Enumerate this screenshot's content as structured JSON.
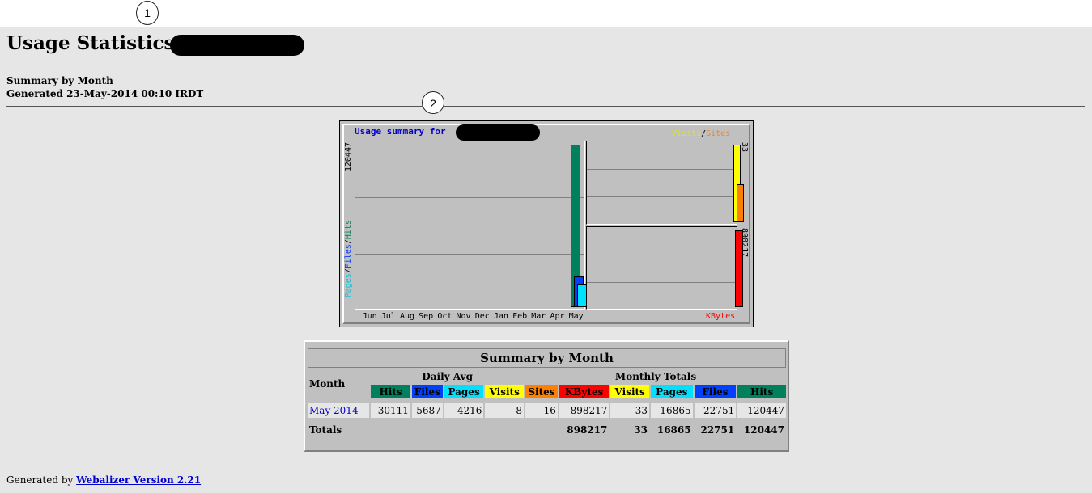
{
  "markers": [
    "1",
    "2"
  ],
  "page": {
    "title": "Usage Statistics for",
    "subtitle_line1": "Summary by Month",
    "subtitle_line2": "Generated 23-May-2014 00:10 IRDT"
  },
  "chart_data": {
    "type": "bar",
    "title": "Usage summary for",
    "categories": [
      "Jun",
      "Jul",
      "Aug",
      "Sep",
      "Oct",
      "Nov",
      "Dec",
      "Jan",
      "Feb",
      "Mar",
      "Apr",
      "May"
    ],
    "main_panel": {
      "max_label": "120447",
      "axis_label_parts": [
        "Pages",
        "/",
        "Files",
        "/",
        "Hits"
      ],
      "series": [
        {
          "name": "Hits",
          "color": "#00805c",
          "values": [
            0,
            0,
            0,
            0,
            0,
            0,
            0,
            0,
            0,
            0,
            0,
            120447
          ]
        },
        {
          "name": "Files",
          "color": "#0040ff",
          "values": [
            0,
            0,
            0,
            0,
            0,
            0,
            0,
            0,
            0,
            0,
            0,
            22751
          ]
        },
        {
          "name": "Pages",
          "color": "#00e0ff",
          "values": [
            0,
            0,
            0,
            0,
            0,
            0,
            0,
            0,
            0,
            0,
            0,
            16865
          ]
        }
      ],
      "ylim": [
        0,
        120447
      ]
    },
    "visits_panel": {
      "max_label": "33",
      "legend": [
        "Visits",
        "/",
        "Sites"
      ],
      "series": [
        {
          "name": "Visits",
          "color": "#ffff00",
          "values": [
            0,
            0,
            0,
            0,
            0,
            0,
            0,
            0,
            0,
            0,
            0,
            33
          ]
        },
        {
          "name": "Sites",
          "color": "#ff8000",
          "values": [
            0,
            0,
            0,
            0,
            0,
            0,
            0,
            0,
            0,
            0,
            0,
            16
          ]
        }
      ],
      "ylim": [
        0,
        33
      ]
    },
    "kbytes_panel": {
      "max_label": "898217",
      "label": "KBytes",
      "series": [
        {
          "name": "KBytes",
          "color": "#ff0000",
          "values": [
            0,
            0,
            0,
            0,
            0,
            0,
            0,
            0,
            0,
            0,
            0,
            898217
          ]
        }
      ],
      "ylim": [
        0,
        898217
      ]
    }
  },
  "table": {
    "title": "Summary by Month",
    "month_header": "Month",
    "daily_avg_header": "Daily Avg",
    "monthly_totals_header": "Monthly Totals",
    "daily_cols": [
      "Hits",
      "Files",
      "Pages",
      "Visits"
    ],
    "monthly_cols": [
      "Sites",
      "KBytes",
      "Visits",
      "Pages",
      "Files",
      "Hits"
    ],
    "rows": [
      {
        "month": "May 2014",
        "values": [
          "30111",
          "5687",
          "4216",
          "8",
          "16",
          "898217",
          "33",
          "16865",
          "22751",
          "120447"
        ]
      }
    ],
    "totals": {
      "label": "Totals",
      "values": [
        "898217",
        "33",
        "16865",
        "22751",
        "120447"
      ]
    }
  },
  "footer": {
    "prefix": "Generated by",
    "link": "Webalizer Version 2.21"
  }
}
